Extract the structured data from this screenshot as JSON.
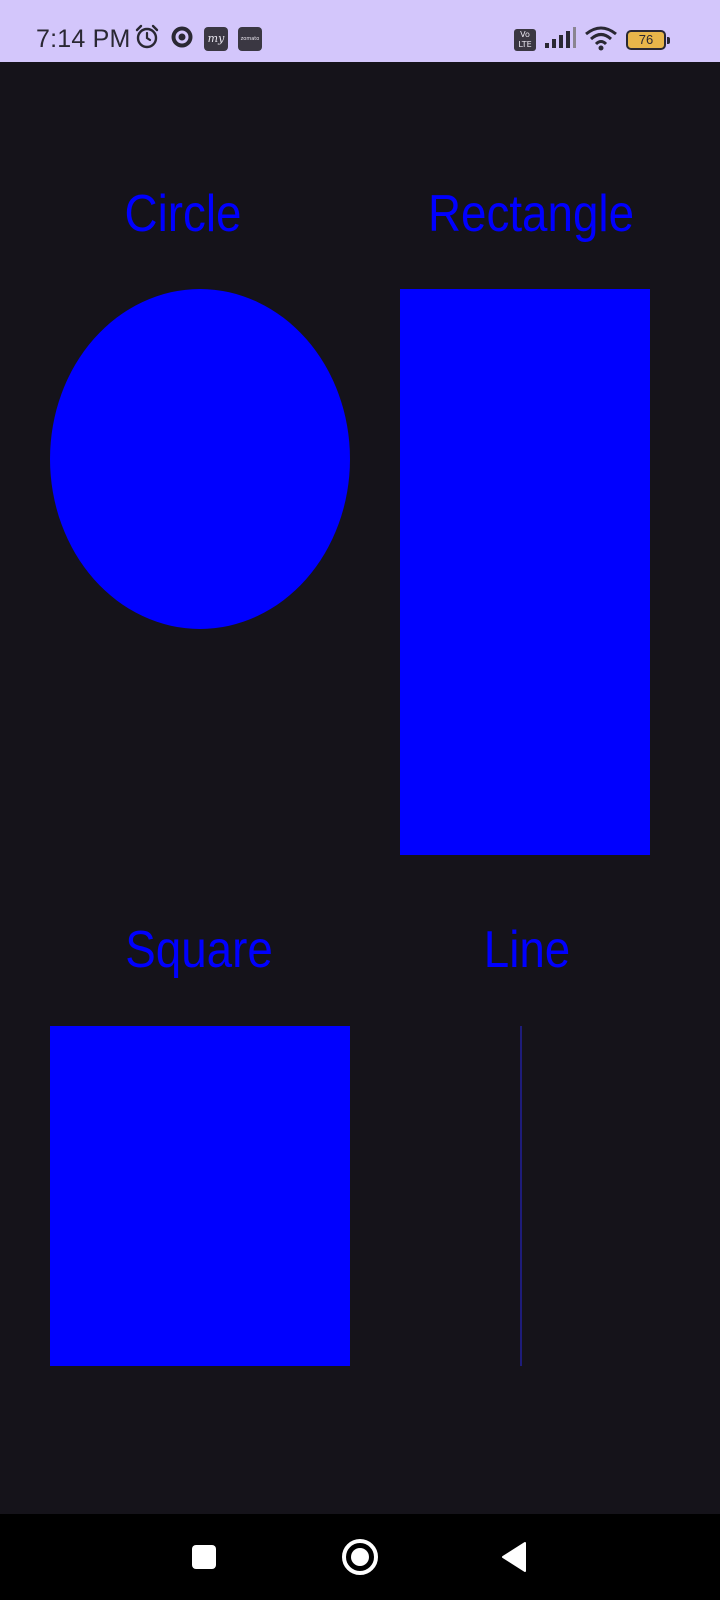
{
  "status_bar": {
    "time": "7:14 PM",
    "notification_icons": [
      "alarm-icon",
      "circle-app-icon",
      "my-app-icon",
      "zomato-app-icon"
    ],
    "app_icon_texts": {
      "my": "my",
      "zomato": "zomato"
    },
    "volte_text": "Vo LTE",
    "battery_level": "76",
    "battery_color": "#e8b64a"
  },
  "shapes": {
    "circle_label": "Circle",
    "rectangle_label": "Rectangle",
    "square_label": "Square",
    "line_label": "Line",
    "shape_color": "#0000ff",
    "line_color": "#1e1c7a"
  },
  "nav_bar": {
    "buttons": [
      "recents-icon",
      "home-icon",
      "back-icon"
    ]
  },
  "colors": {
    "background": "#15131a",
    "status_bar": "#d3c6fb"
  }
}
